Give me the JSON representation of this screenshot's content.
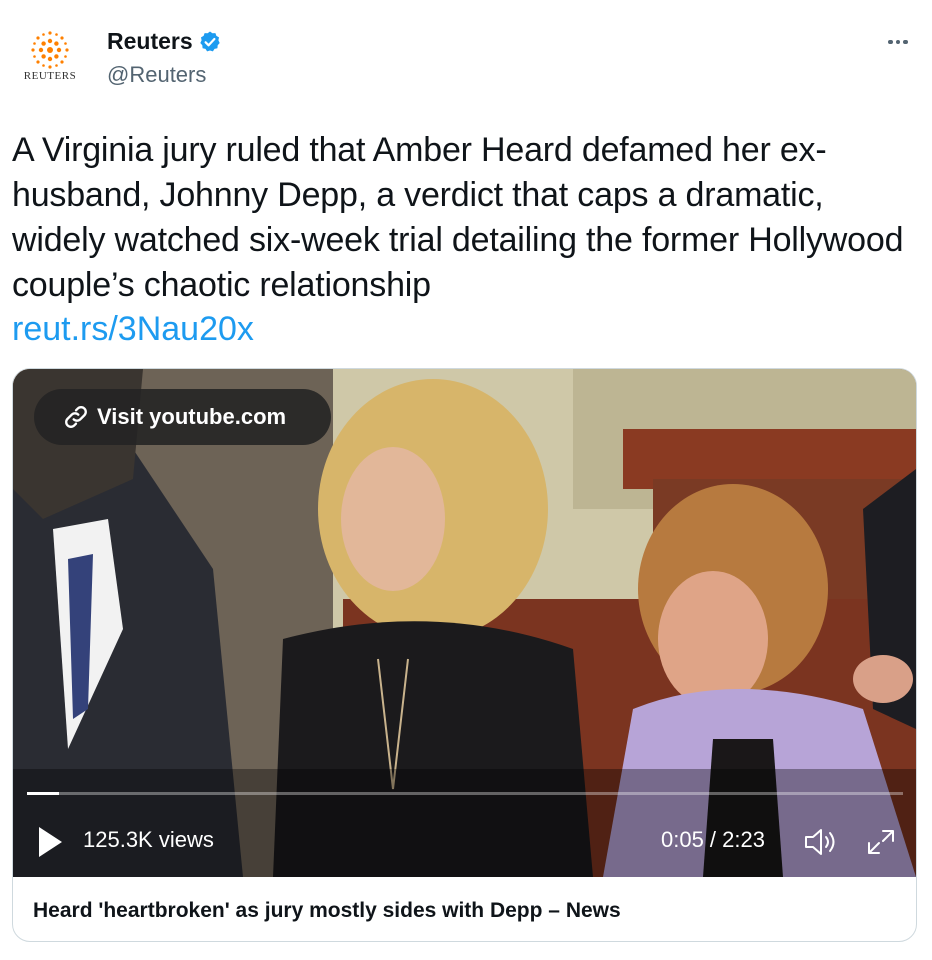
{
  "author": {
    "name": "Reuters",
    "handle": "@Reuters",
    "avatar_wordmark": "REUTERS",
    "verified_icon": "verified-badge-icon",
    "brand_color": "#ff8000"
  },
  "tweet": {
    "text": "A Virginia jury ruled that Amber Heard defamed her ex-husband, Johnny Depp, a verdict that caps a dramatic, widely watched six-week trial detailing the former Hollywood couple’s chaotic relationship",
    "link": "reut.rs/3Nau20x"
  },
  "video": {
    "visit_label": "Visit youtube.com",
    "views": "125.3K views",
    "time": "0:05 / 2:23",
    "progress_fraction": 0.037
  },
  "card": {
    "title": "Heard 'heartbroken' as jury mostly sides with Depp – News"
  },
  "colors": {
    "text": "#0f1419",
    "secondary": "#536471",
    "link": "#1d9bf0",
    "border": "#cfd9de"
  }
}
